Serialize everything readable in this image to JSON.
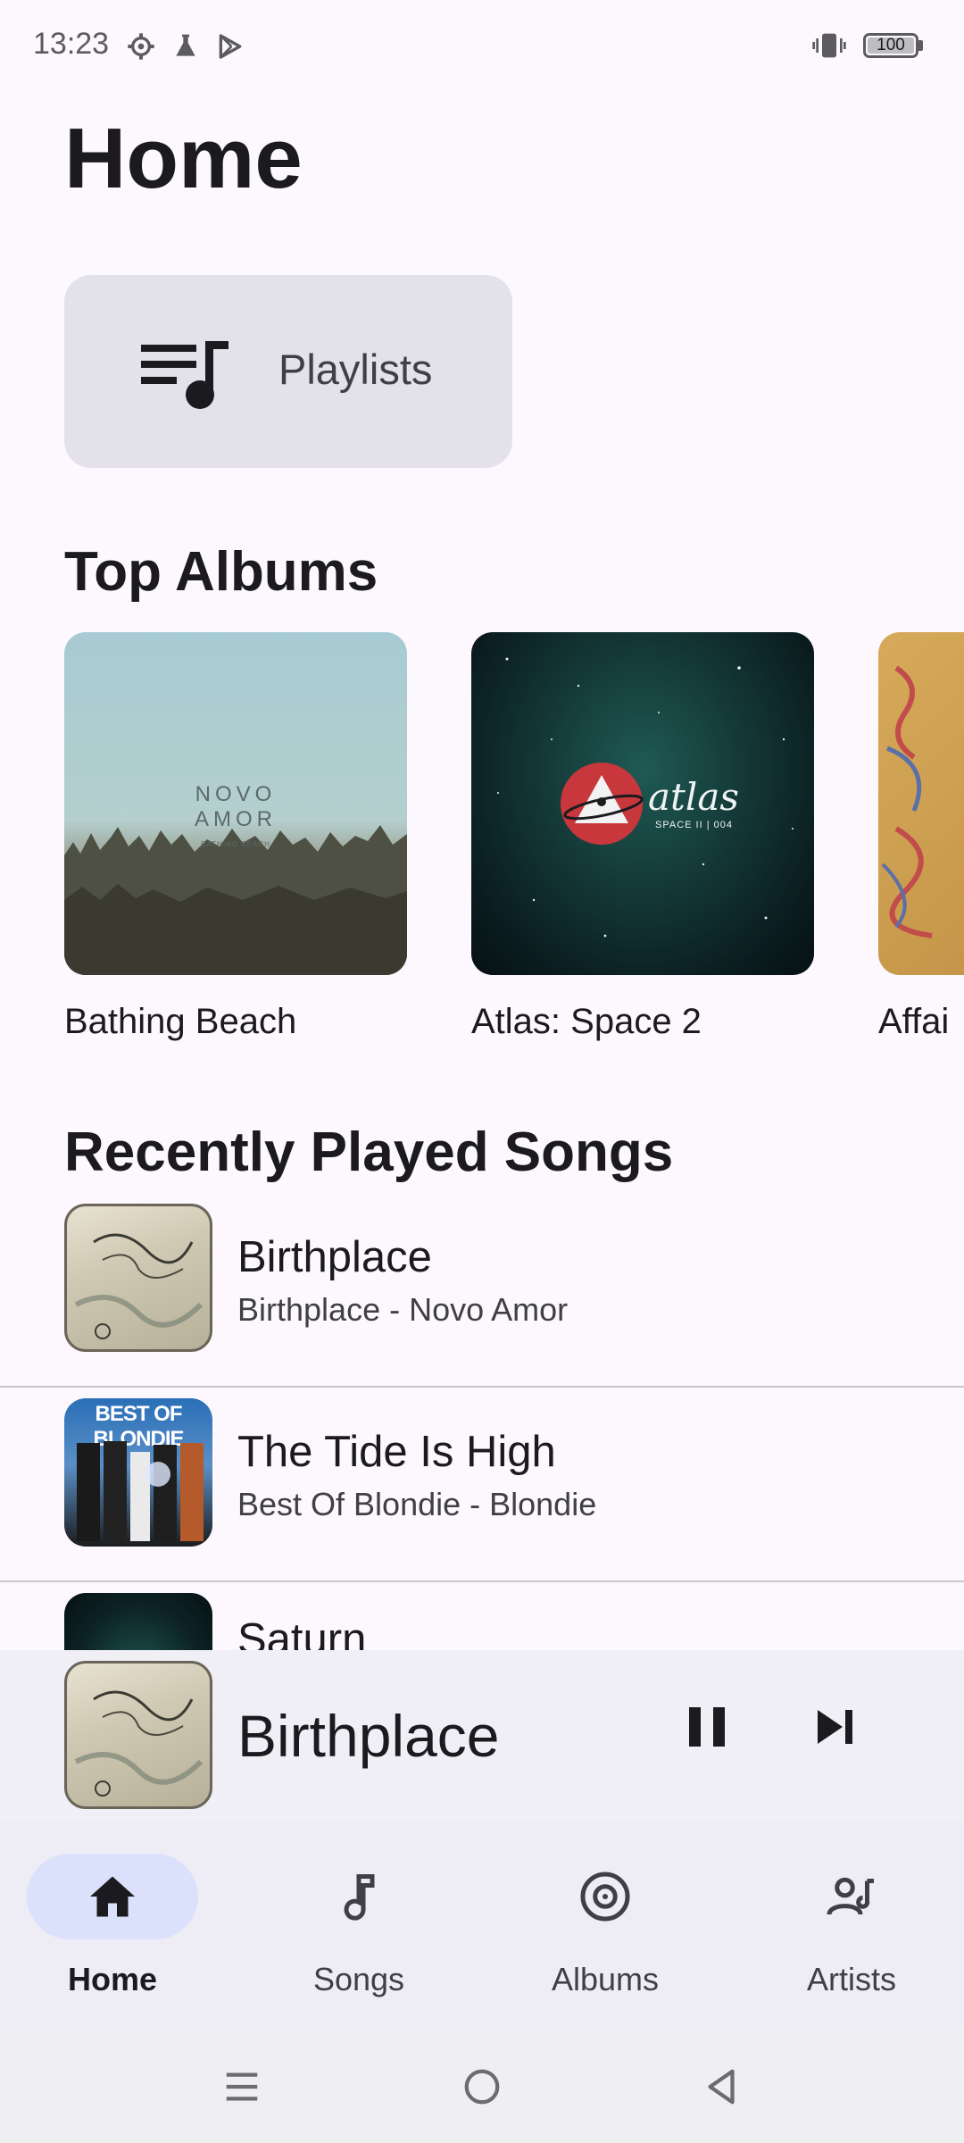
{
  "status_bar": {
    "time": "13:23",
    "battery": "100"
  },
  "header": {
    "title": "Home"
  },
  "playlists_button": {
    "label": "Playlists"
  },
  "top_albums": {
    "title": "Top Albums",
    "albums": [
      {
        "label": "Bathing Beach",
        "art_text_1": "NOVO",
        "art_text_2": "AMOR",
        "art_text_3": "BATHING BEACH"
      },
      {
        "label": "Atlas: Space 2",
        "art_text_1": "atlas",
        "art_text_2": "SPACE II  |  004"
      },
      {
        "label": "Affai"
      }
    ]
  },
  "recently_played": {
    "title": "Recently Played Songs",
    "songs": [
      {
        "title": "Birthplace",
        "subtitle": "Birthplace - Novo Amor"
      },
      {
        "title": "The Tide Is High",
        "subtitle": "Best Of Blondie - Blondie",
        "art_text": "BEST OF BLONDIE"
      },
      {
        "title": "Saturn",
        "subtitle": ""
      }
    ]
  },
  "now_playing": {
    "title": "Birthplace"
  },
  "bottom_nav": {
    "items": [
      {
        "label": "Home",
        "icon": "home-icon",
        "active": true
      },
      {
        "label": "Songs",
        "icon": "music-note-icon",
        "active": false
      },
      {
        "label": "Albums",
        "icon": "album-icon",
        "active": false
      },
      {
        "label": "Artists",
        "icon": "artist-icon",
        "active": false
      }
    ]
  },
  "colors": {
    "background": "#FCF8FD",
    "nav_active": "#DCE1FB",
    "card": "#E3E2EA"
  }
}
